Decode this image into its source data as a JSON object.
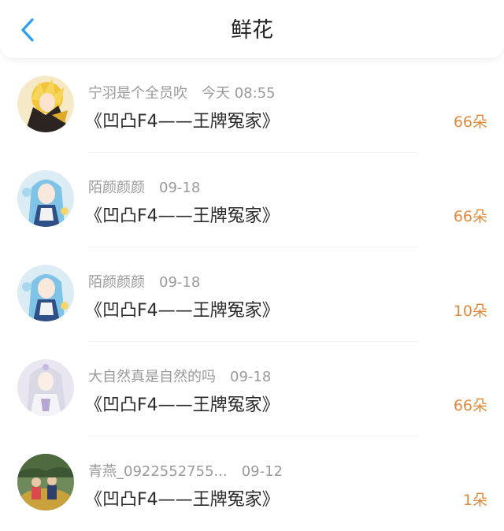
{
  "header": {
    "title": "鲜花",
    "back_icon": "chevron-left-icon",
    "accent_color": "#2a9df4"
  },
  "colors": {
    "count": "#e08a3c",
    "meta": "#9a9a9a"
  },
  "rows": [
    {
      "name": "宁羽是个全员吹",
      "time": "今天 08:55",
      "work": "《凹凸F4——王牌冤家》",
      "count": "66朵",
      "avatar": "yellow-anime-avatar"
    },
    {
      "name": "陌颜颜颜",
      "time": "09-18",
      "work": "《凹凸F4——王牌冤家》",
      "count": "66朵",
      "avatar": "blue-hair-anime-avatar"
    },
    {
      "name": "陌颜颜颜",
      "time": "09-18",
      "work": "《凹凸F4——王牌冤家》",
      "count": "10朵",
      "avatar": "blue-hair-anime-avatar"
    },
    {
      "name": "大自然真是自然的吗",
      "time": "09-18",
      "work": "《凹凸F4——王牌冤家》",
      "count": "66朵",
      "avatar": "white-hair-anime-avatar"
    },
    {
      "name": "青燕_0922552755...",
      "time": "09-12",
      "work": "《凹凸F4——王牌冤家》",
      "count": "1朵",
      "avatar": "photo-avatar"
    }
  ]
}
